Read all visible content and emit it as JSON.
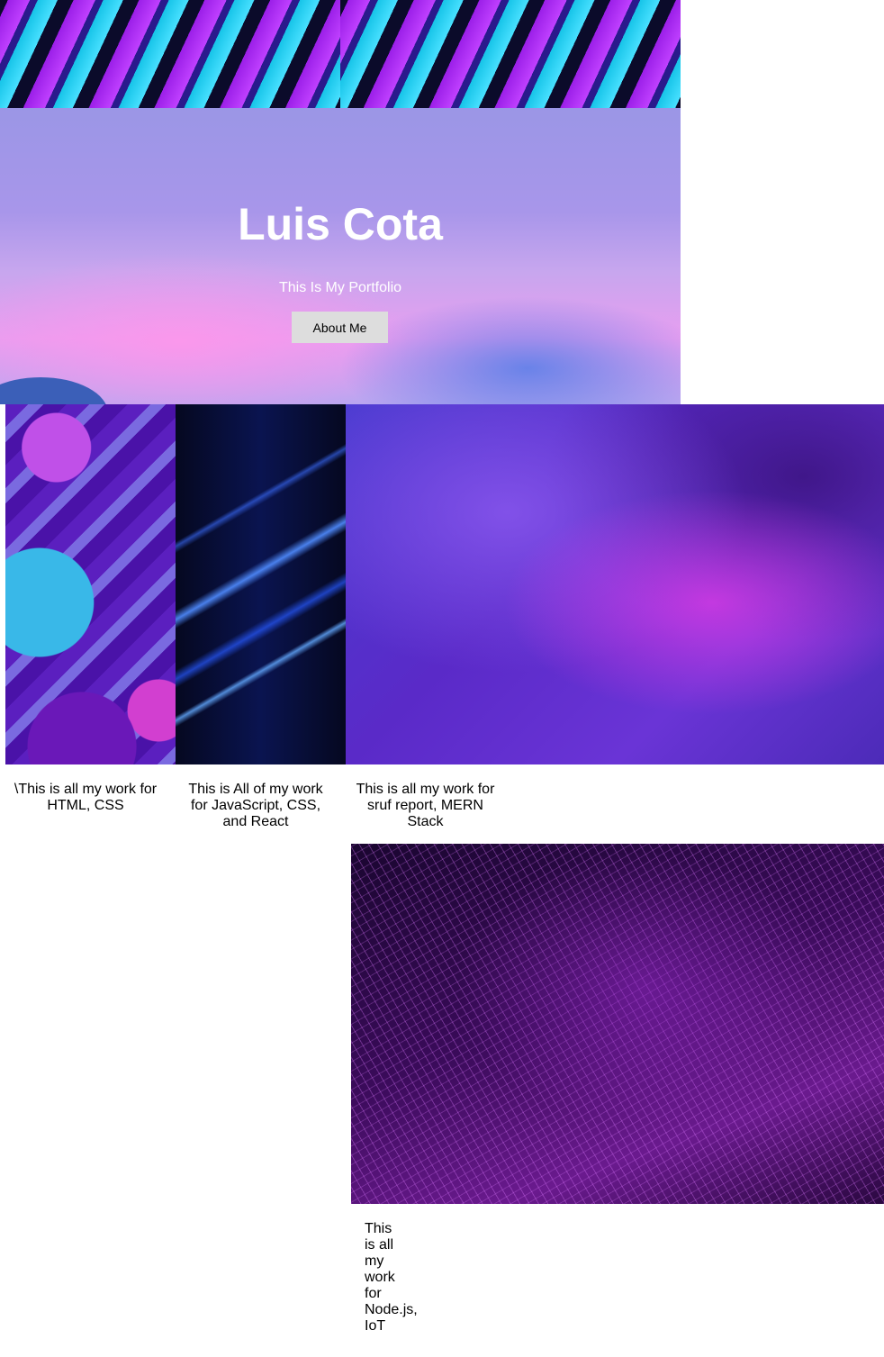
{
  "hero": {
    "title": "Luis Cota",
    "subtitle": "This Is My Portfolio",
    "button_label": "About Me"
  },
  "projects": [
    {
      "caption": "\\This is all my work for HTML, CSS"
    },
    {
      "caption": "This is All of my work for JavaScript, CSS, and React"
    },
    {
      "caption": "This is all my work for sruf report, MERN Stack"
    },
    {
      "caption": "This is all my work for Node.js, IoT"
    }
  ]
}
